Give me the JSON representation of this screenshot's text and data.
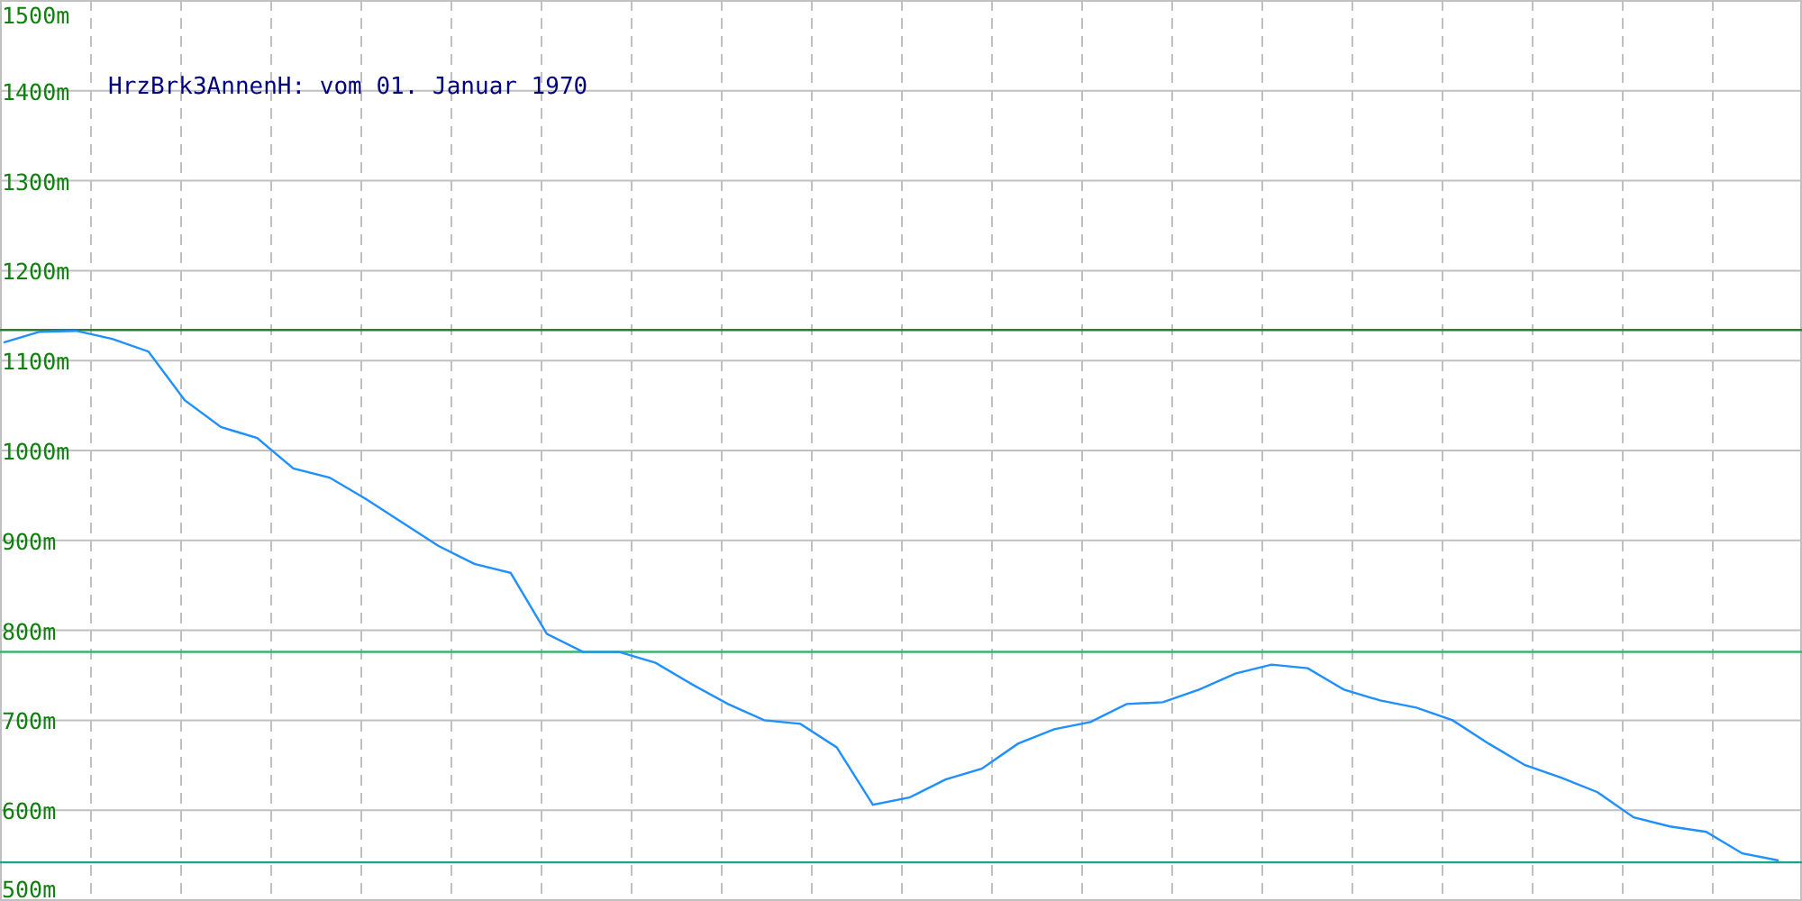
{
  "chart_data": {
    "type": "line",
    "title": "HrzBrk3AnnenH: vom 01. Januar 1970",
    "ylim": [
      500,
      1500
    ],
    "yticks": [
      {
        "value": 1500,
        "label": "1500m"
      },
      {
        "value": 1400,
        "label": "1400m"
      },
      {
        "value": 1300,
        "label": "1300m"
      },
      {
        "value": 1200,
        "label": "1200m"
      },
      {
        "value": 1100,
        "label": "1100m"
      },
      {
        "value": 1000,
        "label": "1000m"
      },
      {
        "value": 900,
        "label": "900m"
      },
      {
        "value": 800,
        "label": "800m"
      },
      {
        "value": 700,
        "label": "700m"
      },
      {
        "value": 600,
        "label": "600m"
      },
      {
        "value": 500,
        "label": "500m"
      }
    ],
    "grid": true,
    "series": [
      {
        "color": "#1e90ff",
        "values": [
          1120,
          1132,
          1133,
          1124,
          1110,
          1056,
          1026,
          1014,
          980,
          970,
          946,
          920,
          894,
          874,
          864,
          796,
          776,
          776,
          764,
          740,
          718,
          700,
          696,
          670,
          606,
          614,
          634,
          646,
          674,
          690,
          698,
          718,
          720,
          734,
          752,
          762,
          758,
          734,
          722,
          714,
          700,
          674,
          650,
          636,
          620,
          592,
          582,
          576,
          552,
          544
        ]
      }
    ],
    "ref_lines": [
      {
        "axis": "y",
        "value": 1134,
        "color": "#2e7d32"
      },
      {
        "axis": "y",
        "value": 776,
        "color": "#3cb371"
      },
      {
        "axis": "y",
        "value": 542,
        "color": "#20a090"
      }
    ]
  }
}
